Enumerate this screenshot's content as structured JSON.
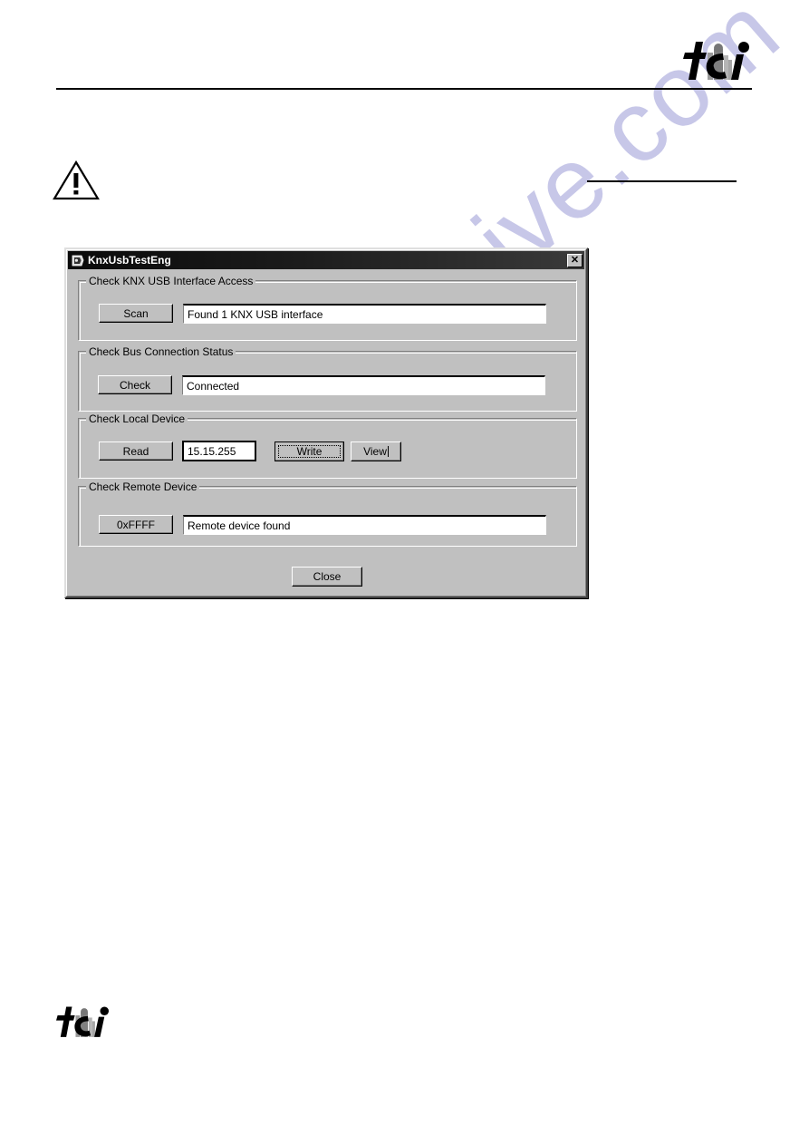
{
  "page": {
    "watermark_text": "manualshive.com",
    "logo_text": "tci",
    "warning_icon": "warning-triangle-icon"
  },
  "dialog": {
    "title": "KnxUsbTestEng",
    "title_icon": "app-icon",
    "close_label": "✕",
    "groups": [
      {
        "label": "Check KNX USB Interface Access",
        "button": "Scan",
        "status": "Found 1 KNX USB interface"
      },
      {
        "label": "Check Bus Connection Status",
        "button": "Check",
        "status": "Connected"
      },
      {
        "label": "Check Local Device",
        "read_button": "Read",
        "address_value": "15.15.255",
        "write_button": "Write",
        "view_button": "View"
      },
      {
        "label": "Check Remote Device",
        "button": "0xFFFF",
        "status": "Remote device found"
      }
    ],
    "close_button": "Close"
  },
  "colors": {
    "dialog_face": "#c0c0c0",
    "titlebar": "#0a0a0a",
    "field_bg": "#ffffff",
    "watermark": "#9a9ad6"
  }
}
